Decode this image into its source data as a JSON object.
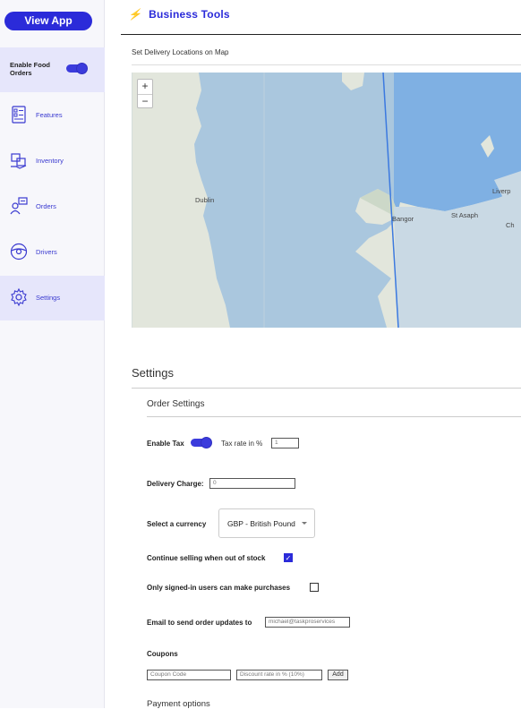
{
  "sidebar": {
    "view_app": "View App",
    "enable_food_orders": "Enable Food Orders",
    "enable_food_orders_on": true,
    "items": [
      {
        "label": "Features",
        "icon": "features-icon"
      },
      {
        "label": "Inventory",
        "icon": "inventory-icon"
      },
      {
        "label": "Orders",
        "icon": "orders-icon"
      },
      {
        "label": "Drivers",
        "icon": "drivers-icon"
      },
      {
        "label": "Settings",
        "icon": "settings-icon",
        "active": true
      }
    ]
  },
  "header": {
    "icon": "lightning-icon",
    "title": "Business Tools"
  },
  "map_section": {
    "label": "Set Delivery Locations on Map",
    "zoom_in": "+",
    "zoom_out": "−",
    "places": [
      "Dublin",
      "Bangor",
      "St Asaph",
      "Liverp",
      "Ch"
    ]
  },
  "settings": {
    "heading": "Settings",
    "order_settings": "Order Settings",
    "enable_tax_label": "Enable Tax",
    "enable_tax_on": true,
    "tax_rate_label": "Tax rate in %",
    "tax_rate_value": "1",
    "delivery_charge_label": "Delivery Charge:",
    "delivery_charge_value": "0",
    "currency_label": "Select a currency",
    "currency_value": "GBP - British Pound",
    "continue_selling_label": "Continue selling when out of stock",
    "continue_selling_checked": true,
    "signed_in_label": "Only signed-in users can make purchases",
    "signed_in_checked": false,
    "email_label": "Email to send order updates to",
    "email_value": "michael@taskproservices",
    "coupons_label": "Coupons",
    "coupon_code_placeholder": "Coupon Code",
    "discount_placeholder": "Discount rate in % (10%)",
    "add_label": "Add",
    "payment_options": "Payment options"
  },
  "colors": {
    "accent": "#2b2bd9",
    "sidebar_active": "#e6e6fb"
  }
}
